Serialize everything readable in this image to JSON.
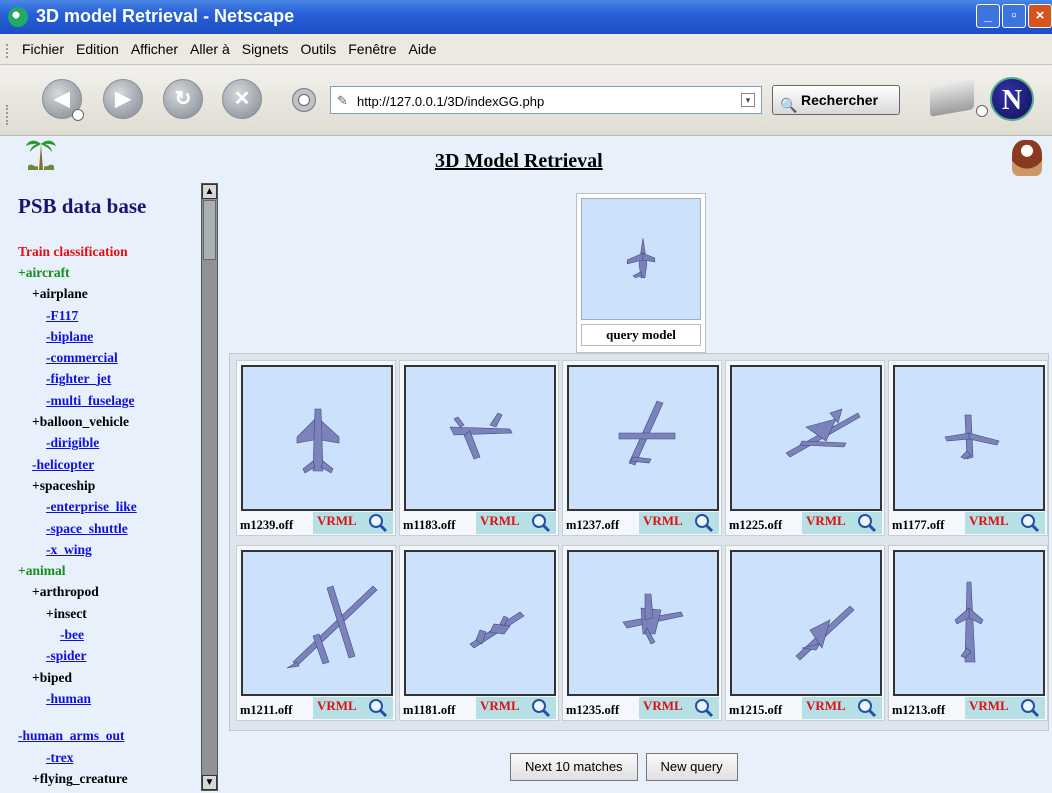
{
  "window": {
    "title": "3D model Retrieval - Netscape"
  },
  "menu": [
    "Fichier",
    "Edition",
    "Afficher",
    "Aller à",
    "Signets",
    "Outils",
    "Fenêtre",
    "Aide"
  ],
  "toolbar": {
    "url": "http://127.0.0.1/3D/indexGG.php",
    "search_label": "Rechercher"
  },
  "sidebar": {
    "title": "PSB data base",
    "classification": "Train classification",
    "tree": [
      {
        "text": "+aircraft",
        "style": "green",
        "indent": 0
      },
      {
        "text": "+airplane",
        "style": "black",
        "indent": 1
      },
      {
        "text": "-F117",
        "style": "link",
        "indent": 2
      },
      {
        "text": "-biplane",
        "style": "link",
        "indent": 2
      },
      {
        "text": "-commercial",
        "style": "link",
        "indent": 2
      },
      {
        "text": "-fighter_jet",
        "style": "link",
        "indent": 2
      },
      {
        "text": "-multi_fuselage",
        "style": "link",
        "indent": 2
      },
      {
        "text": "+balloon_vehicle",
        "style": "black",
        "indent": 1
      },
      {
        "text": "-dirigible",
        "style": "link",
        "indent": 2
      },
      {
        "text": "-helicopter",
        "style": "link",
        "indent": 1
      },
      {
        "text": "+spaceship",
        "style": "black",
        "indent": 1
      },
      {
        "text": "-enterprise_like",
        "style": "link",
        "indent": 2
      },
      {
        "text": "-space_shuttle",
        "style": "link",
        "indent": 2
      },
      {
        "text": "-x_wing",
        "style": "link",
        "indent": 2
      },
      {
        "text": "+animal",
        "style": "green",
        "indent": 0
      },
      {
        "text": "+arthropod",
        "style": "black",
        "indent": 1
      },
      {
        "text": "+insect",
        "style": "black",
        "indent": 2
      },
      {
        "text": "-bee",
        "style": "link",
        "indent": 3
      },
      {
        "text": "-spider",
        "style": "link",
        "indent": 2
      },
      {
        "text": "+biped",
        "style": "black",
        "indent": 1
      },
      {
        "text": "-human",
        "style": "link",
        "indent": 2
      },
      {
        "text": "",
        "style": "black",
        "indent": 0
      },
      {
        "text": "-human_arms_out",
        "style": "link",
        "indent": 0
      },
      {
        "text": "-trex",
        "style": "link",
        "indent": 2
      },
      {
        "text": "+flying_creature",
        "style": "black",
        "indent": 1
      }
    ]
  },
  "main": {
    "title": "3D Model Retrieval",
    "query_label": "query model",
    "vrml_label": "VRML",
    "results": [
      {
        "file": "m1239.off",
        "variant": "topdown"
      },
      {
        "file": "m1183.off",
        "variant": "tilted"
      },
      {
        "file": "m1237.off",
        "variant": "airliner"
      },
      {
        "file": "m1225.off",
        "variant": "swept"
      },
      {
        "file": "m1177.off",
        "variant": "small"
      },
      {
        "file": "m1211.off",
        "variant": "diagonal"
      },
      {
        "file": "m1181.off",
        "variant": "side"
      },
      {
        "file": "m1235.off",
        "variant": "fighter"
      },
      {
        "file": "m1215.off",
        "variant": "angled"
      },
      {
        "file": "m1213.off",
        "variant": "vertical"
      }
    ],
    "next_button": "Next 10 matches",
    "new_query_button": "New query"
  }
}
